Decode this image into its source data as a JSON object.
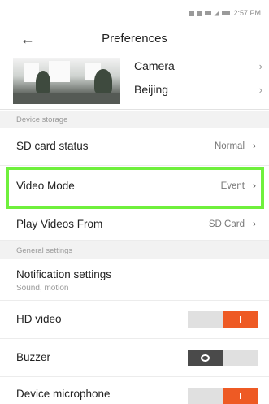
{
  "status_bar": {
    "time": "2:57 PM"
  },
  "header": {
    "back_icon": "back-arrow-icon",
    "title": "Preferences"
  },
  "device": {
    "name": "Camera",
    "location": "Beijing",
    "chevron_icon": "chevron-right-icon"
  },
  "sections": {
    "device_storage": "Device storage",
    "general_settings": "General settings"
  },
  "storage": {
    "sd_card": {
      "label": "SD card status",
      "value": "Normal"
    },
    "video_mode": {
      "label": "Video Mode",
      "value": "Event"
    },
    "play_from": {
      "label": "Play Videos From",
      "value": "SD Card"
    }
  },
  "general": {
    "notifications": {
      "label": "Notification settings",
      "sub": "Sound, motion"
    },
    "hd_video": {
      "label": "HD video",
      "state": "on"
    },
    "buzzer": {
      "label": "Buzzer",
      "state": "off"
    },
    "microphone": {
      "label": "Device microphone",
      "state": "on"
    }
  },
  "colors": {
    "highlight": "#6ff03c",
    "toggle_on": "#ee5a24",
    "toggle_off": "#4a4a4a"
  }
}
